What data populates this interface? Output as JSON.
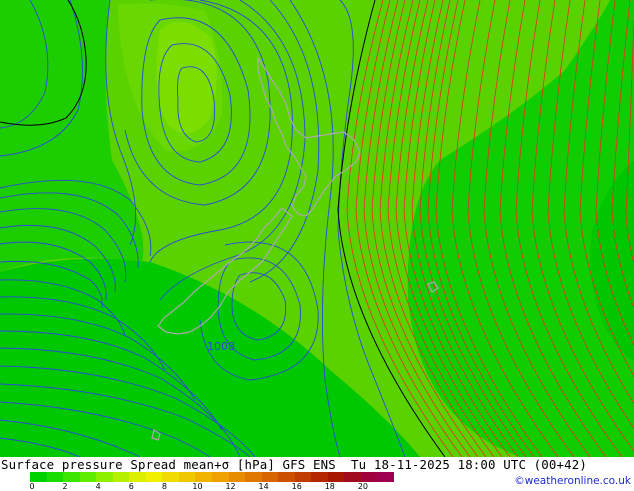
{
  "title": "Surface pressure Spread mean+σ [hPa] GFS ENS  Tu 18-11-2025 18:00 UTC (00+42)",
  "contour_label": "1008",
  "credit": "©weatheronline.co.uk",
  "legend": {
    "colors": [
      "#00d200",
      "#19dc00",
      "#3ce600",
      "#5fee00",
      "#8cf000",
      "#b4f000",
      "#dcf000",
      "#f0f000",
      "#f0dc00",
      "#f0c800",
      "#f0b400",
      "#f0a000",
      "#e88c00",
      "#e07800",
      "#d86400",
      "#cc5000",
      "#c03c00",
      "#b42800",
      "#a81800",
      "#a00c1e",
      "#a0003c",
      "#a00050"
    ],
    "ticks": [
      "0",
      "2",
      "4",
      "6",
      "8",
      "10",
      "12",
      "14",
      "16",
      "18",
      "20"
    ]
  }
}
